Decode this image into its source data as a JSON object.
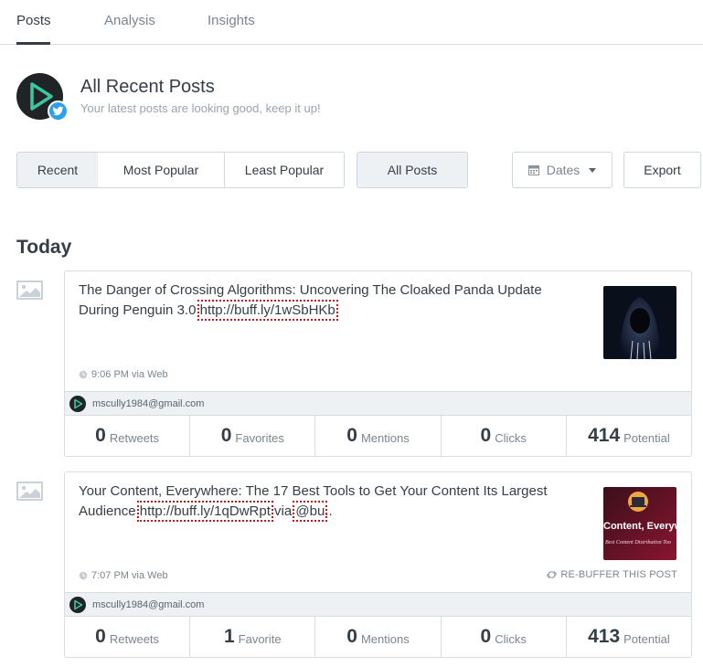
{
  "tabs": [
    {
      "label": "Posts"
    },
    {
      "label": "Analysis"
    },
    {
      "label": "Insights"
    }
  ],
  "profile": {
    "title": "All Recent Posts",
    "subtitle": "Your latest posts are looking good, keep it up!",
    "network_icon": "twitter-icon"
  },
  "filters": {
    "sort": [
      "Recent",
      "Most Popular",
      "Least Popular"
    ],
    "selected_sort": "Recent",
    "post_type": "All Posts",
    "dates": "Dates",
    "export": "Export"
  },
  "section": {
    "heading": "Today"
  },
  "posts": [
    {
      "text_before": "The Danger of Crossing Algorithms: Uncovering The Cloaked Panda Update During Penguin 3.0",
      "link": "http://buff.ly/1wSbHKb",
      "text_after": "",
      "extra_link": "",
      "tail": "",
      "time": "9:06 PM via Web",
      "rebuffer": "",
      "account": "mscully1984@gmail.com",
      "stats": [
        {
          "value": "0",
          "label": "Retweets"
        },
        {
          "value": "0",
          "label": "Favorites"
        },
        {
          "value": "0",
          "label": "Mentions"
        },
        {
          "value": "0",
          "label": "Clicks"
        },
        {
          "value": "414",
          "label": "Potential"
        }
      ]
    },
    {
      "text_before": "Your Content, Everywhere: The 17 Best Tools to Get Your Content Its Largest Audience",
      "link": "http://buff.ly/1qDwRpt",
      "text_after": " via ",
      "extra_link": "@bu",
      "tail": "..",
      "time": "7:07 PM via Web",
      "rebuffer": "RE-BUFFER THIS POST",
      "account": "mscully1984@gmail.com",
      "thumb_text": "Content, Everyw",
      "thumb_subtext": "Best Content Distribution Too",
      "stats": [
        {
          "value": "0",
          "label": "Retweets"
        },
        {
          "value": "1",
          "label": "Favorite"
        },
        {
          "value": "0",
          "label": "Mentions"
        },
        {
          "value": "0",
          "label": "Clicks"
        },
        {
          "value": "413",
          "label": "Potential"
        }
      ]
    }
  ],
  "colors": {
    "accent": "#2e9fe8",
    "brand_green": "#3fc6a0",
    "text": "#343e47",
    "muted": "#7b8590",
    "link_outline": "#c7161b"
  }
}
